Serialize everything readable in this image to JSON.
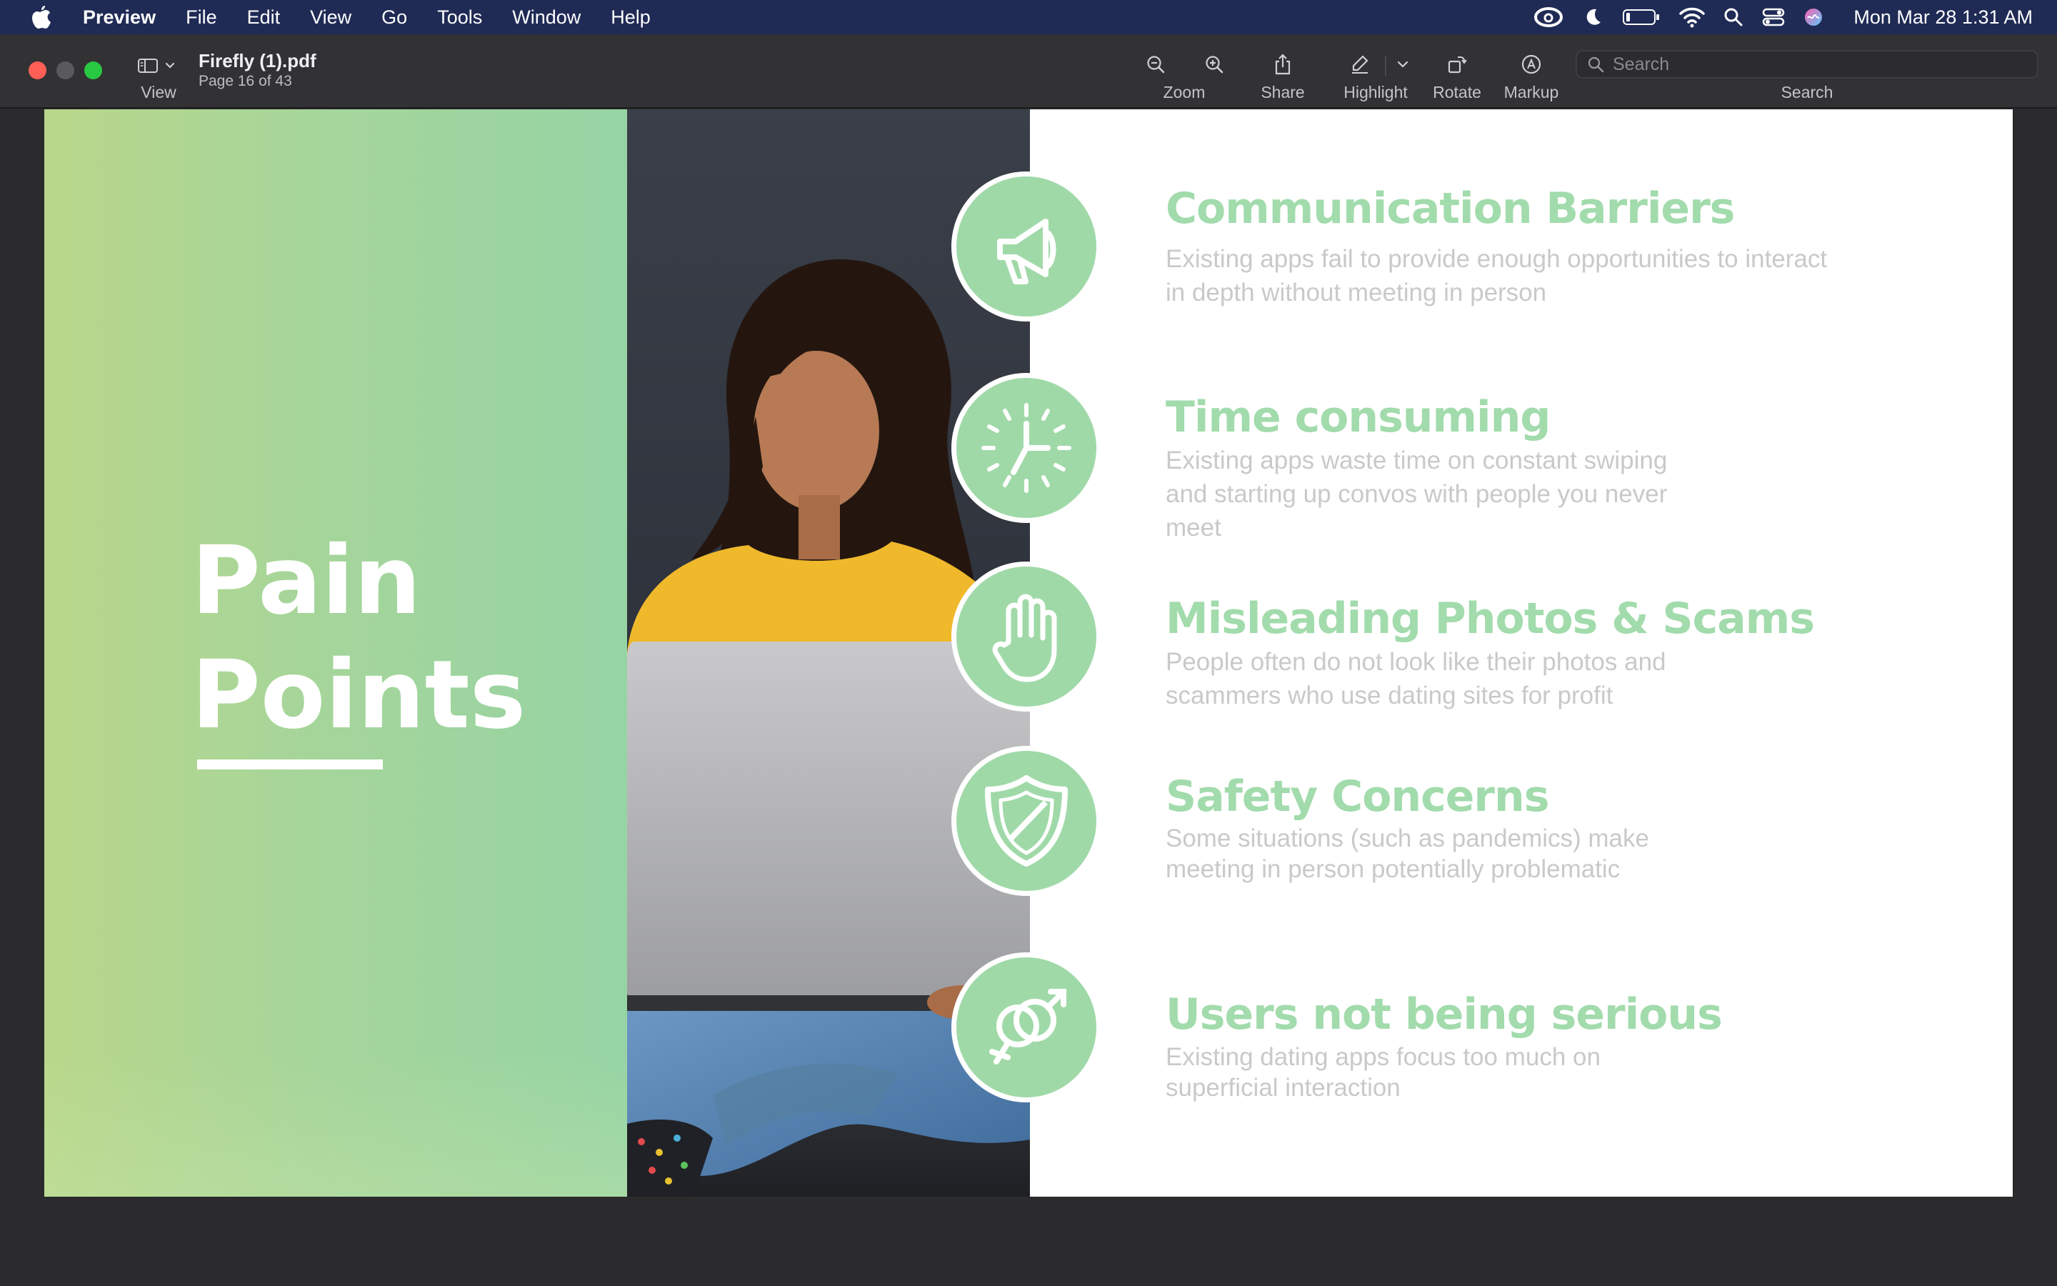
{
  "menubar": {
    "app_name": "Preview",
    "menus": [
      "File",
      "Edit",
      "View",
      "Go",
      "Tools",
      "Window",
      "Help"
    ],
    "clock": "Mon Mar 28  1:31 AM"
  },
  "toolbar": {
    "view_label": "View",
    "doc_title": "Firefly (1).pdf",
    "doc_subtitle": "Page 16 of 43",
    "zoom_label": "Zoom",
    "share_label": "Share",
    "highlight_label": "Highlight",
    "rotate_label": "Rotate",
    "markup_label": "Markup",
    "search_label": "Search",
    "search_placeholder": "Search"
  },
  "slide": {
    "title_line1": "Pain",
    "title_line2": "Points",
    "colors": {
      "accent_green": "#a2dbac",
      "desc_gray": "#c9c9c9"
    },
    "items": [
      {
        "icon": "megaphone-icon",
        "heading": "Communication Barriers",
        "lines": [
          "Existing apps fail to provide enough opportunities to interact",
          "in depth without meeting in person"
        ]
      },
      {
        "icon": "clock-icon",
        "heading": "Time consuming",
        "lines": [
          "Existing apps waste time on constant swiping",
          "and starting up convos with people you never",
          "meet"
        ]
      },
      {
        "icon": "hand-icon",
        "heading": "Misleading Photos & Scams",
        "lines": [
          "People often  do not look like their photos and",
          "scammers who use dating sites for profit"
        ]
      },
      {
        "icon": "shield-icon",
        "heading": "Safety Concerns",
        "lines": [
          "Some situations (such as pandemics) make",
          "meeting in person potentially problematic"
        ]
      },
      {
        "icon": "gender-symbols-icon",
        "heading": "Users not being serious",
        "lines": [
          "Existing dating apps focus too much on",
          "superficial interaction"
        ]
      }
    ]
  }
}
